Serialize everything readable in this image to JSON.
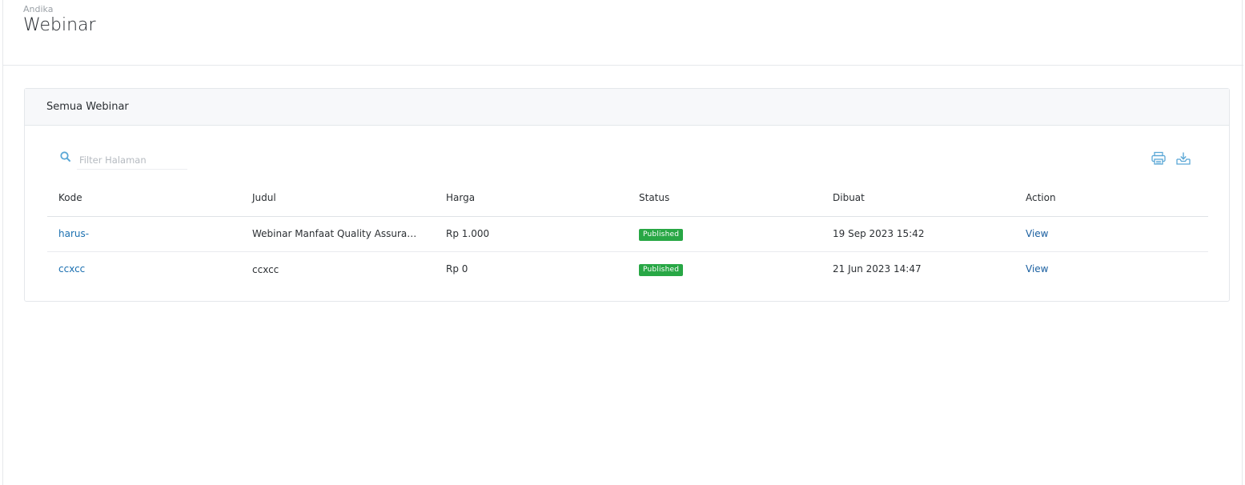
{
  "header": {
    "breadcrumb": "Andika",
    "title": "Webinar"
  },
  "card": {
    "title": "Semua Webinar"
  },
  "search": {
    "placeholder": "Filter Halaman",
    "value": ""
  },
  "toolbar": {
    "print_icon": "printer-icon",
    "download_icon": "download-icon"
  },
  "colors": {
    "accent": "#5aa7d6",
    "link": "#1a6fb0",
    "badge_published": "#28a745"
  },
  "table": {
    "columns": [
      "Kode",
      "Judul",
      "Harga",
      "Status",
      "Dibuat",
      "Action"
    ],
    "rows": [
      {
        "kode": "harus-",
        "judul": "Webinar Manfaat Quality Assurance...",
        "harga": "Rp 1.000",
        "status": "Published",
        "dibuat": "19 Sep 2023 15:42",
        "action": "View"
      },
      {
        "kode": "ccxcc",
        "judul": "ccxcc",
        "harga": "Rp 0",
        "status": "Published",
        "dibuat": "21 Jun 2023 14:47",
        "action": "View"
      }
    ]
  }
}
